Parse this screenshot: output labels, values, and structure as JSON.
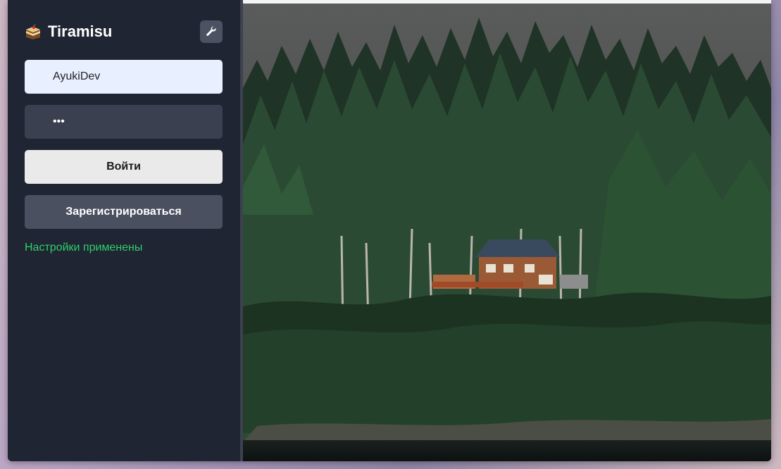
{
  "app": {
    "title": "Tiramisu",
    "logo_icon": "cake-icon",
    "settings_icon": "wrench-icon"
  },
  "login_form": {
    "username_value": "AyukiDev",
    "password_value": "•••",
    "login_label": "Войти",
    "register_label": "Зарегистрироваться",
    "status_text": "Настройки применены"
  },
  "colors": {
    "sidebar_bg": "#1f2533",
    "status_green": "#2fcf6a",
    "username_bg": "#e8efff",
    "password_bg": "#3a4050"
  },
  "background_image": {
    "subject": "house-in-pine-forest-photo"
  }
}
